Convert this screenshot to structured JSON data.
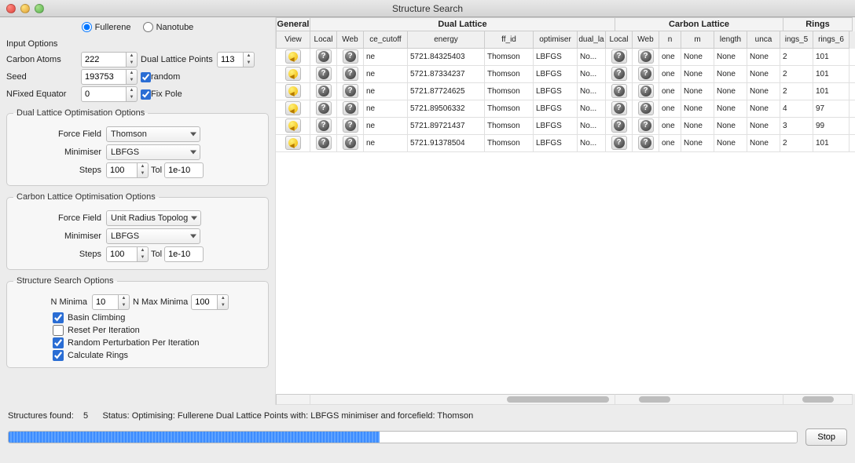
{
  "window": {
    "title": "Structure Search"
  },
  "mode": {
    "fullerene": "Fullerene",
    "nanotube": "Nanotube"
  },
  "input": {
    "section": "Input Options",
    "carbon_label": "Carbon Atoms",
    "carbon": "222",
    "dlp_label": "Dual Lattice Points",
    "dlp": "113",
    "seed_label": "Seed",
    "seed": "193753",
    "random_label": "random",
    "nfixed_label": "NFixed Equator",
    "nfixed": "0",
    "fixpole_label": "Fix Pole"
  },
  "dual_opt": {
    "legend": "Dual Lattice Optimisation Options",
    "ff_label": "Force Field",
    "ff": "Thomson",
    "min_label": "Minimiser",
    "min": "LBFGS",
    "steps_label": "Steps",
    "steps": "100",
    "tol_label": "Tol",
    "tol": "1e-10"
  },
  "carbon_opt": {
    "legend": "Carbon Lattice Optimisation Options",
    "ff_label": "Force Field",
    "ff": "Unit Radius Topolog",
    "min_label": "Minimiser",
    "min": "LBFGS",
    "steps_label": "Steps",
    "steps": "100",
    "tol_label": "Tol",
    "tol": "1e-10"
  },
  "search_opt": {
    "legend": "Structure Search Options",
    "nmin_label": "N Minima",
    "nmin": "10",
    "nmax_label": "N Max Minima",
    "nmax": "100",
    "basin": "Basin Climbing",
    "reset": "Reset Per Iteration",
    "perturb": "Random Perturbation Per Iteration",
    "rings": "Calculate Rings"
  },
  "groups": {
    "general": "General",
    "dual": "Dual Lattice",
    "carbon": "Carbon Lattice",
    "rings": "Rings"
  },
  "cols": {
    "view": "View",
    "local": "Local",
    "web": "Web",
    "ecut": "ce_cutoff",
    "energy": "energy",
    "ff": "ff_id",
    "opt": "optimiser",
    "dlat": "dual_la",
    "clocal": "Local",
    "cweb": "Web",
    "n": "n",
    "m": "m",
    "length": "length",
    "unca": "unca",
    "r5": "ings_5",
    "r6": "rings_6"
  },
  "rows": [
    {
      "ecut": "ne",
      "energy": "5721.84325403",
      "ff": "Thomson",
      "opt": "LBFGS",
      "dl": "No...",
      "one": "one",
      "n": "None",
      "m": "None",
      "len": "None",
      "un": "None",
      "r5": "2",
      "r6": "101"
    },
    {
      "ecut": "ne",
      "energy": "5721.87334237",
      "ff": "Thomson",
      "opt": "LBFGS",
      "dl": "No...",
      "one": "one",
      "n": "None",
      "m": "None",
      "len": "None",
      "un": "None",
      "r5": "2",
      "r6": "101"
    },
    {
      "ecut": "ne",
      "energy": "5721.87724625",
      "ff": "Thomson",
      "opt": "LBFGS",
      "dl": "No...",
      "one": "one",
      "n": "None",
      "m": "None",
      "len": "None",
      "un": "None",
      "r5": "2",
      "r6": "101"
    },
    {
      "ecut": "ne",
      "energy": "5721.89506332",
      "ff": "Thomson",
      "opt": "LBFGS",
      "dl": "No...",
      "one": "one",
      "n": "None",
      "m": "None",
      "len": "None",
      "un": "None",
      "r5": "4",
      "r6": "97"
    },
    {
      "ecut": "ne",
      "energy": "5721.89721437",
      "ff": "Thomson",
      "opt": "LBFGS",
      "dl": "No...",
      "one": "one",
      "n": "None",
      "m": "None",
      "len": "None",
      "un": "None",
      "r5": "3",
      "r6": "99"
    },
    {
      "ecut": "ne",
      "energy": "5721.91378504",
      "ff": "Thomson",
      "opt": "LBFGS",
      "dl": "No...",
      "one": "one",
      "n": "None",
      "m": "None",
      "len": "None",
      "un": "None",
      "r5": "2",
      "r6": "101"
    }
  ],
  "footer": {
    "structures_label": "Structures found:",
    "count": "5",
    "status_label": "Status:",
    "status": "Optimising: Fullerene Dual Lattice Points with: LBFGS minimiser and forcefield: Thomson",
    "stop": "Stop"
  }
}
